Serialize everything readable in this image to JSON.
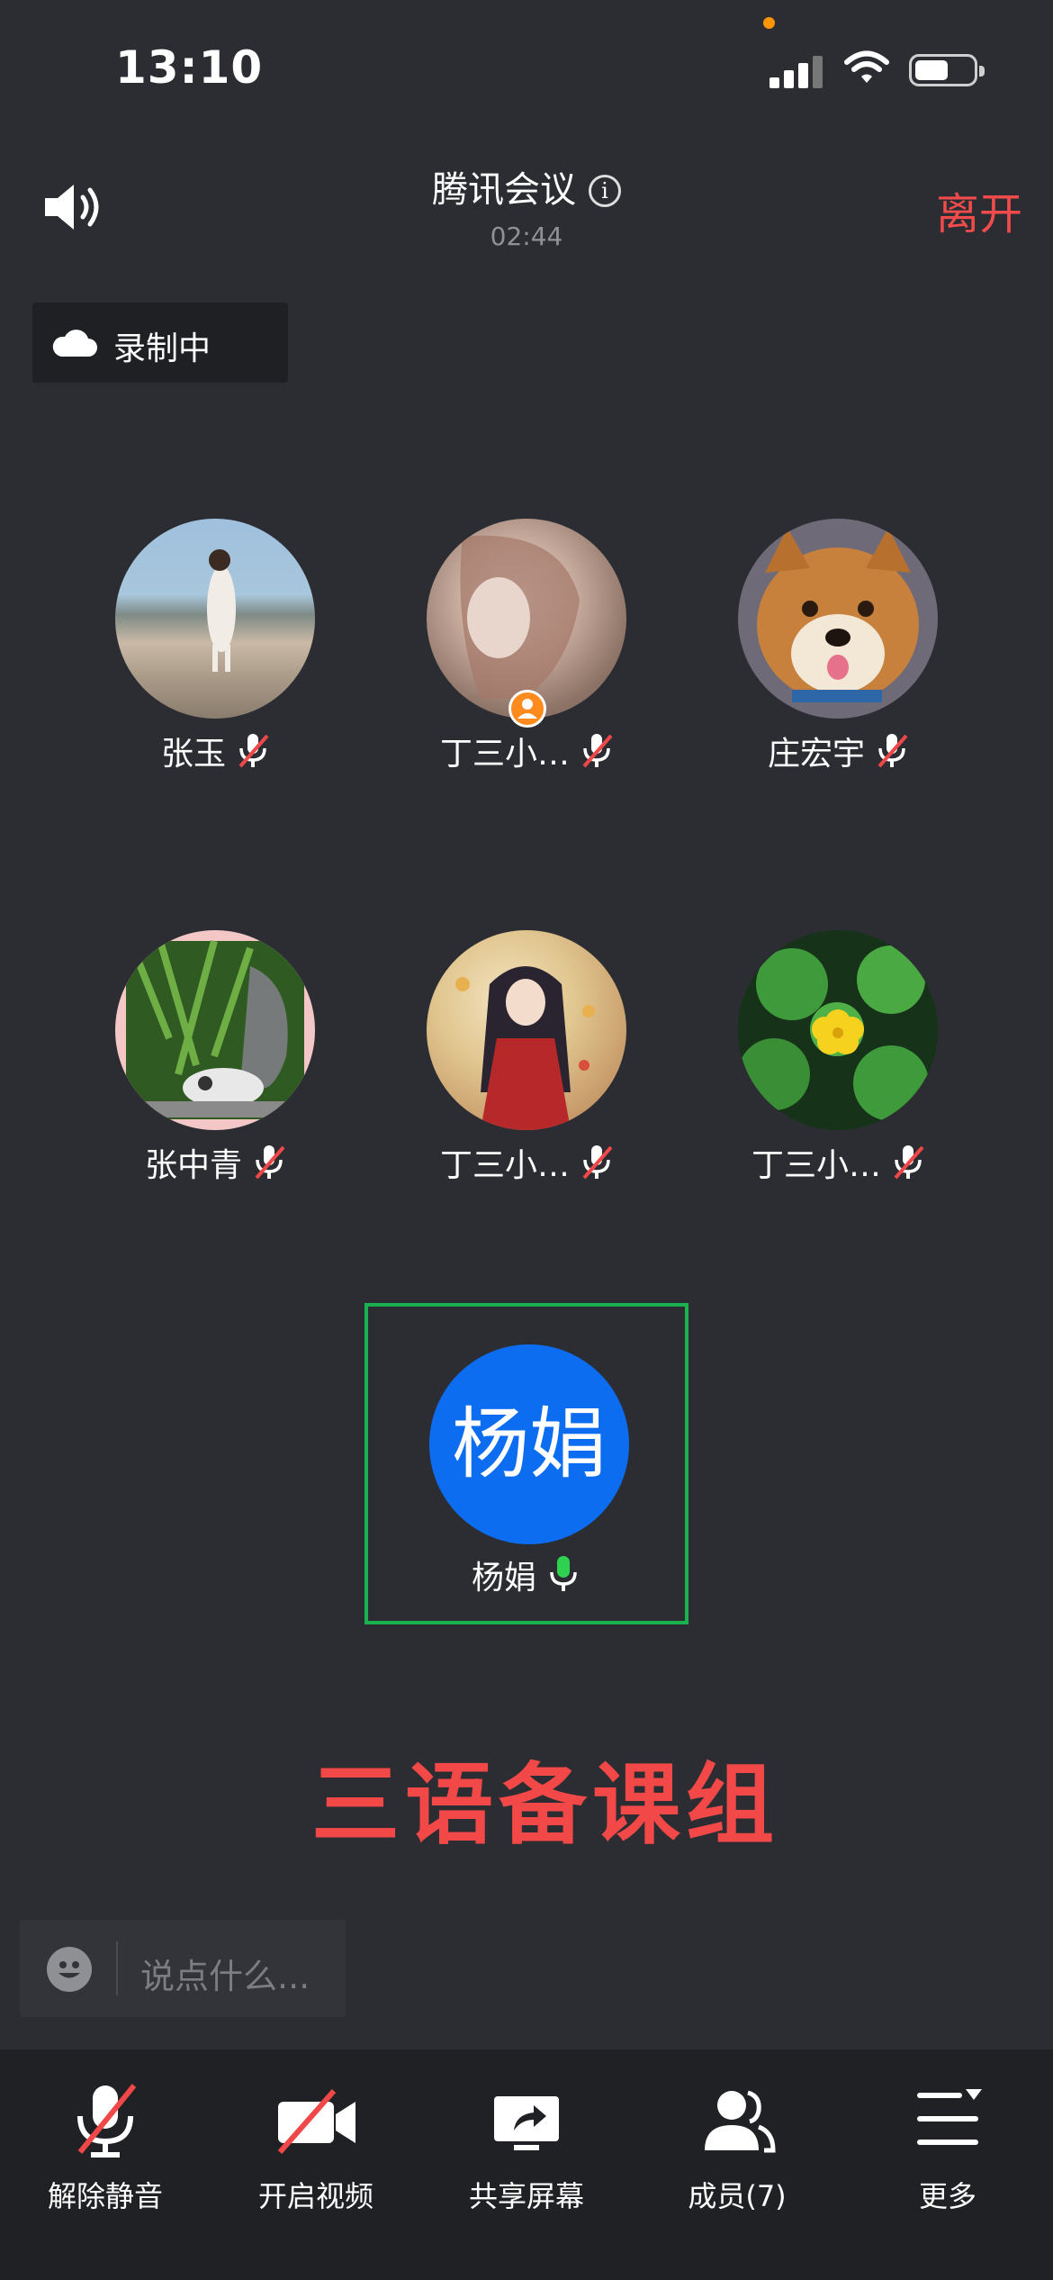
{
  "status_bar": {
    "time": "13:10"
  },
  "header": {
    "title": "腾讯会议",
    "timer": "02:44",
    "leave_label": "离开"
  },
  "recording": {
    "label": "录制中"
  },
  "participants": [
    {
      "name": "张玉",
      "mic": "muted"
    },
    {
      "name": "丁三小…",
      "mic": "muted",
      "host": true
    },
    {
      "name": "庄宏宇",
      "mic": "muted"
    },
    {
      "name": "张中青",
      "mic": "muted"
    },
    {
      "name": "丁三小…",
      "mic": "muted"
    },
    {
      "name": "丁三小…",
      "mic": "muted"
    }
  ],
  "active_speaker": {
    "avatar_text": "杨娟",
    "name": "杨娟",
    "mic": "on"
  },
  "group_title": "三语备课组",
  "chat": {
    "placeholder": "说点什么..."
  },
  "toolbar": {
    "unmute": "解除静音",
    "video": "开启视频",
    "share": "共享屏幕",
    "members": "成员(7)",
    "more": "更多"
  },
  "colors": {
    "accent_red": "#f24b4b",
    "speaker_green": "#19b24e",
    "avatar_blue": "#0d6df0",
    "host_orange": "#ff8a1e"
  },
  "icons": [
    "speaker-icon",
    "info-icon",
    "cloud-icon",
    "mic-off-icon",
    "mic-icon",
    "video-off-icon",
    "share-screen-icon",
    "members-icon",
    "more-icon",
    "emoji-icon"
  ]
}
